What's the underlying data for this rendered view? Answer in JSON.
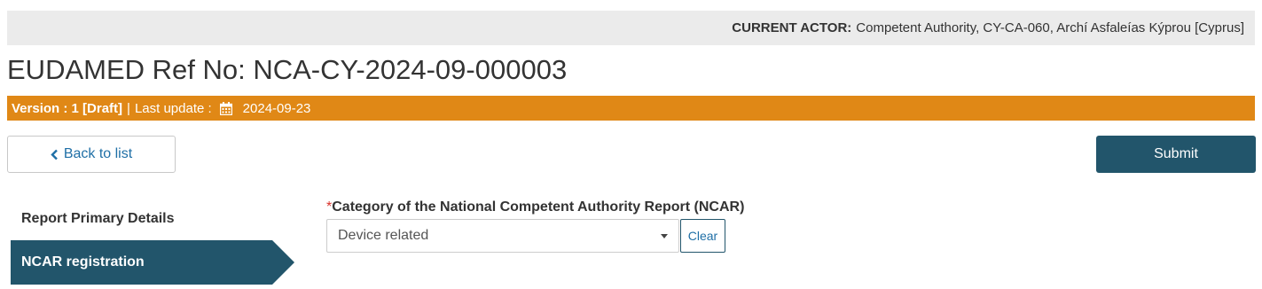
{
  "actor_bar": {
    "label": "CURRENT ACTOR:",
    "value": "Competent Authority, CY-CA-060, Archí Asfaleías Kýprou [Cyprus]"
  },
  "page": {
    "title": "EUDAMED Ref No: NCA-CY-2024-09-000003"
  },
  "version_bar": {
    "version": "Version : 1 [Draft]",
    "separator": "|",
    "last_update_label": "Last update :",
    "date_icon": "calendar-icon",
    "last_update_date": "2024-09-23",
    "color": "#e08816"
  },
  "toolbar": {
    "back_icon": "chevron-left-icon",
    "back_label": "Back to list",
    "submit_label": "Submit",
    "submit_color": "#22556b"
  },
  "side_nav": {
    "items": [
      {
        "label": "Report Primary Details",
        "active": false
      },
      {
        "label": "NCAR registration",
        "active": true
      }
    ],
    "active_color": "#22556b"
  },
  "form": {
    "category": {
      "required_marker": "*",
      "label": "Category of the National Competent Authority Report (NCAR)",
      "value": "Device related",
      "clear_label": "Clear"
    }
  }
}
